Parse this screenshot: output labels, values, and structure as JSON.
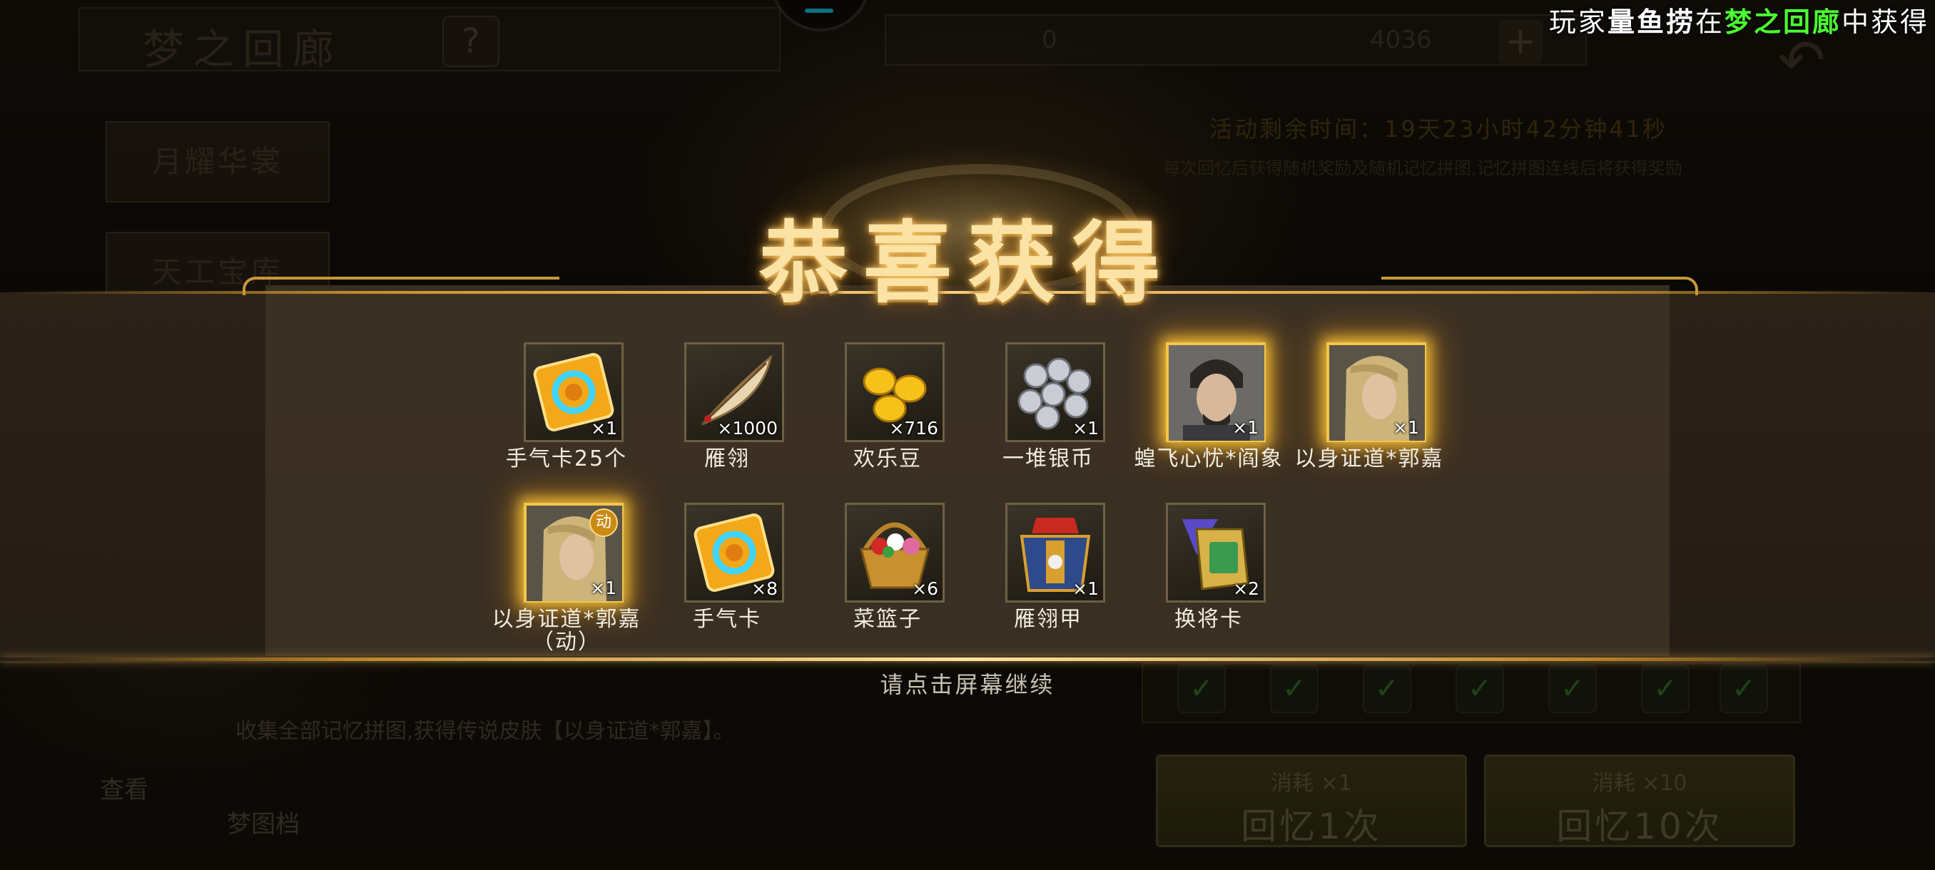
{
  "background": {
    "title": "梦之回廊",
    "help_label": "?",
    "counter_a": "0",
    "counter_b": "4036",
    "plus_label": "+",
    "tabs": [
      "月耀华裳",
      "天工宝库"
    ],
    "timer": "活动剩余时间：19天23小时42分钟41秒",
    "hint": "每次回忆后获得随机奖励及随机记忆拼图,记忆拼图连线后将获得奖励",
    "description": "收集全部记忆拼图,获得传说皮肤【以身证道*郭嘉】。",
    "view_label": "查看",
    "map_label": "梦图档",
    "buttons": [
      {
        "cost": "消耗 ×1",
        "label": "回忆1次"
      },
      {
        "cost": "消耗 ×10",
        "label": "回忆10次"
      }
    ]
  },
  "ticker": {
    "prefix": "玩家",
    "player": "量鱼捞",
    "middle": "在",
    "place": "梦之回廊",
    "suffix": "中获得"
  },
  "reward": {
    "title": "恭喜获得",
    "continue_text": "请点击屏幕继续",
    "items": [
      {
        "name": "手气卡25个",
        "qty": "×1",
        "icon": "luck-card-icon",
        "rare": false
      },
      {
        "name": "雁翎",
        "qty": "×1000",
        "icon": "feather-icon",
        "rare": false
      },
      {
        "name": "欢乐豆",
        "qty": "×716",
        "icon": "gold-beans-icon",
        "rare": false
      },
      {
        "name": "一堆银币",
        "qty": "×1",
        "icon": "silver-coins-icon",
        "rare": false
      },
      {
        "name": "蝗飞心忧*阎象",
        "qty": "×1",
        "icon": "hero-portrait-yanxiang",
        "rare": true
      },
      {
        "name": "以身证道*郭嘉",
        "qty": "×1",
        "icon": "hero-portrait-guojia",
        "rare": true
      },
      {
        "name": "以身证道*郭嘉（动）",
        "qty": "×1",
        "icon": "hero-portrait-guojia-animated",
        "rare": true,
        "badge": "动"
      },
      {
        "name": "手气卡",
        "qty": "×8",
        "icon": "luck-card-icon",
        "rare": false
      },
      {
        "name": "菜篮子",
        "qty": "×6",
        "icon": "basket-icon",
        "rare": false
      },
      {
        "name": "雁翎甲",
        "qty": "×1",
        "icon": "armor-icon",
        "rare": false
      },
      {
        "name": "换将卡",
        "qty": "×2",
        "icon": "swap-card-icon",
        "rare": false
      }
    ]
  }
}
